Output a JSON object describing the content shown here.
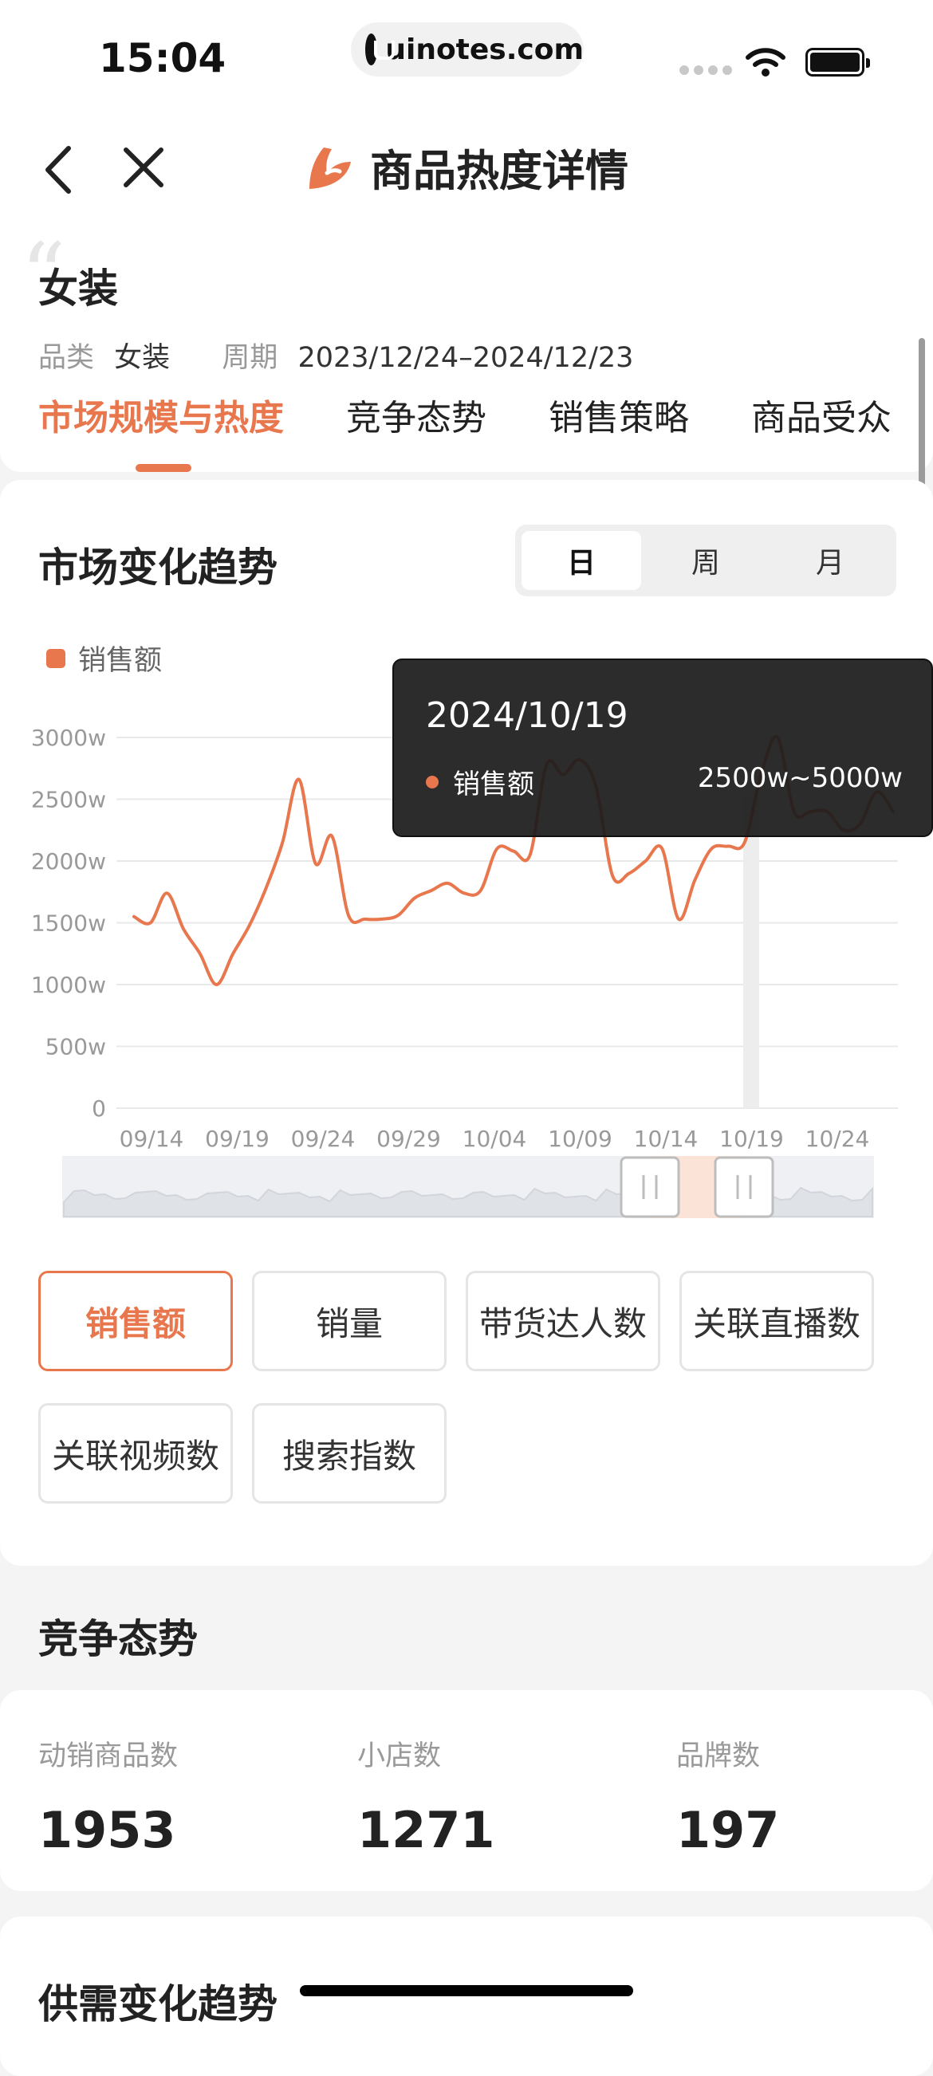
{
  "status": {
    "time": "15:04",
    "url": "uinotes.com"
  },
  "header": {
    "title": "商品热度详情"
  },
  "product": {
    "name": "女装",
    "category_label": "品类",
    "category_value": "女装",
    "period_label": "周期",
    "period_value": "2023/12/24–2024/12/23"
  },
  "tabs": [
    "市场规模与热度",
    "竞争态势",
    "销售策略",
    "商品受众"
  ],
  "market_section": {
    "title": "市场变化趋势",
    "segments": [
      "日",
      "周",
      "月"
    ],
    "legend": "销售额",
    "tooltip": {
      "date": "2024/10/19",
      "series": "销售额",
      "value": "2500w~5000w"
    },
    "metric_buttons": [
      "销售额",
      "销量",
      "带货达人数",
      "关联直播数",
      "关联视频数",
      "搜索指数"
    ]
  },
  "chart_data": {
    "type": "line",
    "series": [
      {
        "name": "销售额",
        "values": [
          1550,
          1500,
          1740,
          1450,
          1250,
          1000,
          1250,
          1480,
          1780,
          2150,
          2660,
          1980,
          2200,
          1560,
          1530,
          1530,
          1560,
          1700,
          1760,
          1820,
          1740,
          1760,
          2100,
          2080,
          2050,
          2780,
          2700,
          2820,
          2600,
          1880,
          1900,
          2000,
          2100,
          1530,
          1850,
          2100,
          2120,
          2150,
          2700,
          3000,
          2400,
          2400,
          2400,
          2250,
          2300,
          2560,
          2400
        ]
      }
    ],
    "x_tick_labels": [
      "09/14",
      "09/19",
      "09/24",
      "09/29",
      "10/04",
      "10/09",
      "10/14",
      "10/19",
      "10/24"
    ],
    "y_tick_labels": [
      "0",
      "500w",
      "1000w",
      "1500w",
      "2000w",
      "2500w",
      "3000w"
    ],
    "ylim": [
      0,
      3000
    ],
    "highlight": "10/19",
    "grid": true,
    "color": "#e8774e"
  },
  "competition": {
    "title": "竞争态势",
    "stats": [
      {
        "label": "动销商品数",
        "value": "1953"
      },
      {
        "label": "小店数",
        "value": "1271"
      },
      {
        "label": "品牌数",
        "value": "197"
      }
    ]
  },
  "supply_section": {
    "title": "供需变化趋势"
  },
  "colors": {
    "accent": "#e8774e"
  }
}
